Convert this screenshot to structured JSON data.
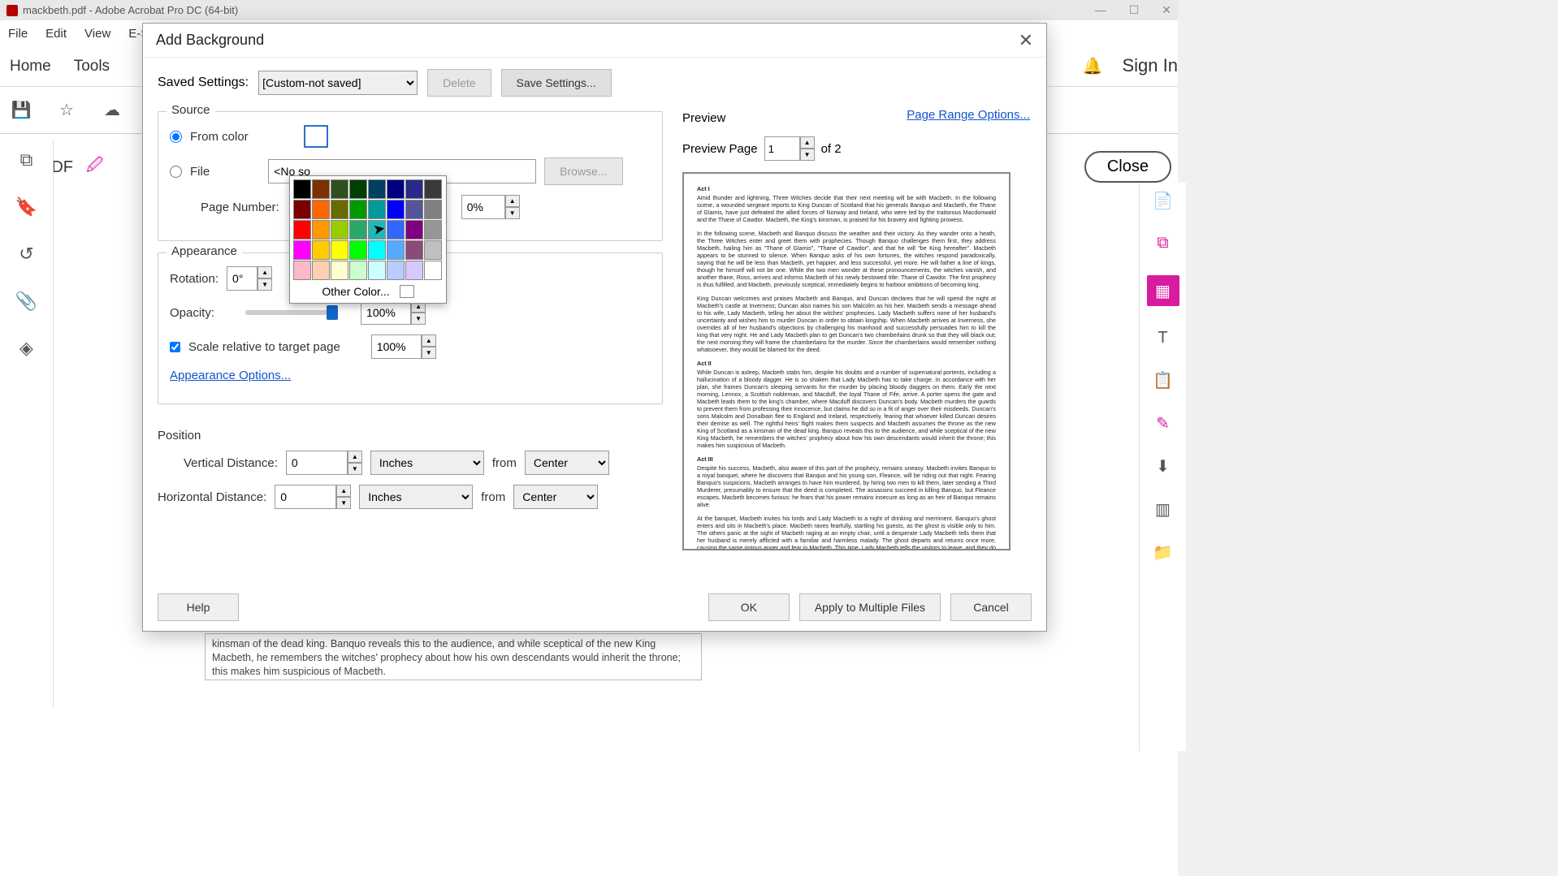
{
  "app": {
    "title": "mackbeth.pdf - Adobe Acrobat Pro DC (64-bit)"
  },
  "menu": {
    "file": "File",
    "edit": "Edit",
    "view": "View",
    "esign": "E-Si"
  },
  "topTabs": {
    "home": "Home",
    "tools": "Tools"
  },
  "signIn": "Sign In",
  "editPdf": "Edit PDF",
  "closeBtn": "Close",
  "dialog": {
    "title": "Add Background",
    "savedSettingsLabel": "Saved Settings:",
    "savedSettingsValue": "[Custom-not saved]",
    "delete": "Delete",
    "saveSettings": "Save Settings...",
    "pageRange": "Page Range Options...",
    "sourceLabel": "Source",
    "fromColor": "From color",
    "file": "File",
    "fileValue": "<No so",
    "browse": "Browse...",
    "pageNumberLabel": "Page Number:",
    "pageNumberValue": "0%",
    "appearanceLabel": "Appearance",
    "rotationLabel": "Rotation:",
    "rotationValue": "0°",
    "opacityLabel": "Opacity:",
    "opacityValue": "100%",
    "scaleLabel": "Scale relative to target page",
    "scaleValue": "100%",
    "appearanceOptions": "Appearance Options...",
    "positionLabel": "Position",
    "vDistLabel": "Vertical Distance:",
    "hDistLabel": "Horizontal Distance:",
    "distValue": "0",
    "unit": "Inches",
    "from": "from",
    "anchor": "Center",
    "help": "Help",
    "ok": "OK",
    "apply": "Apply to Multiple Files",
    "cancel": "Cancel",
    "previewLabel": "Preview",
    "previewPageLabel": "Preview Page",
    "previewPageValue": "1",
    "previewPageTotal": "of 2",
    "otherColor": "Other Color..."
  },
  "colorGrid": [
    "#000000",
    "#7b3100",
    "#2f4f1f",
    "#004000",
    "#003f5f",
    "#000080",
    "#2a2a8a",
    "#3a3a3a",
    "#7a0000",
    "#ff6600",
    "#6a6a00",
    "#009900",
    "#009a9a",
    "#0000ff",
    "#555599",
    "#808080",
    "#ff0000",
    "#ff9900",
    "#99cc00",
    "#2aa86a",
    "#1fb8b8",
    "#3366ff",
    "#800080",
    "#969696",
    "#ff00ff",
    "#ffcc00",
    "#ffff00",
    "#00ff00",
    "#00ffff",
    "#55aaff",
    "#8a4a7a",
    "#c0c0c0",
    "#ffb8c8",
    "#ffd0b0",
    "#ffffcc",
    "#ccffcc",
    "#ccffff",
    "#b8ccff",
    "#d8c8ff",
    "#ffffff"
  ],
  "bottomDoc": "kinsman of the dead king. Banquo reveals this to the audience, and while sceptical of the new King Macbeth, he remembers the witches' prophecy about how his own descendants would inherit the throne; this makes him suspicious of Macbeth.",
  "previewText": {
    "act1": "Act I",
    "p1": "Amid thunder and lightning, Three Witches decide that their next meeting will be with Macbeth. In the following scene, a wounded sergeant reports to King Duncan of Scotland that his generals Banquo and Macbeth, the Thane of Glamis, have just defeated the allied forces of Norway and Ireland, who were led by the traitorous Macdonwald and the Thane of Cawdor. Macbeth, the King's kinsman, is praised for his bravery and fighting prowess.",
    "p2": "In the following scene, Macbeth and Banquo discuss the weather and their victory. As they wander onto a heath, the Three Witches enter and greet them with prophecies. Though Banquo challenges them first, they address Macbeth, hailing him as \"Thane of Glamis\", \"Thane of Cawdor\", and that he will \"be King hereafter\". Macbeth appears to be stunned to silence. When Banquo asks of his own fortunes, the witches respond paradoxically, saying that he will be less than Macbeth, yet happier, and less successful, yet more. He will father a line of kings, though he himself will not be one. While the two men wonder at these pronouncements, the witches vanish, and another thane, Ross, arrives and informs Macbeth of his newly bestowed title: Thane of Cawdor. The first prophecy is thus fulfilled, and Macbeth, previously sceptical, immediately begins to harbour ambitions of becoming king.",
    "p3": "King Duncan welcomes and praises Macbeth and Banquo, and Duncan declares that he will spend the night at Macbeth's castle at Inverness; Duncan also names his son Malcolm as his heir. Macbeth sends a message ahead to his wife, Lady Macbeth, telling her about the witches' prophecies. Lady Macbeth suffers none of her husband's uncertainty and wishes him to murder Duncan in order to obtain kingship. When Macbeth arrives at Inverness, she overrides all of her husband's objections by challenging his manhood and successfully persuades him to kill the king that very night. He and Lady Macbeth plan to get Duncan's two chamberlains drunk so that they will black out; the next morning they will frame the chamberlains for the murder. Since the chamberlains would remember nothing whatsoever, they would be blamed for the deed.",
    "act2": "Act II",
    "p4": "While Duncan is asleep, Macbeth stabs him, despite his doubts and a number of supernatural portents, including a hallucination of a bloody dagger. He is so shaken that Lady Macbeth has to take charge. In accordance with her plan, she frames Duncan's sleeping servants for the murder by placing bloody daggers on them. Early the next morning, Lennox, a Scottish nobleman, and Macduff, the loyal Thane of Fife, arrive. A porter opens the gate and Macbeth leads them to the king's chamber, where Macduff discovers Duncan's body. Macbeth murders the guards to prevent them from professing their innocence, but claims he did so in a fit of anger over their misdeeds. Duncan's sons Malcolm and Donalbain flee to England and Ireland, respectively, fearing that whoever killed Duncan desires their demise as well. The rightful heirs' flight makes them suspects and Macbeth assumes the throne as the new King of Scotland as a kinsman of the dead king. Banquo reveals this to the audience, and while sceptical of the new King Macbeth, he remembers the witches' prophecy about how his own descendants would inherit the throne; this makes him suspicious of Macbeth.",
    "act3": "Act III",
    "p5": "Despite his success, Macbeth, also aware of this part of the prophecy, remains uneasy. Macbeth invites Banquo to a royal banquet, where he discovers that Banquo and his young son, Fleance, will be riding out that night. Fearing Banquo's suspicions, Macbeth arranges to have him murdered, by hiring two men to kill them, later sending a Third Murderer, presumably to ensure that the deed is completed. The assassins succeed in killing Banquo, but Fleance escapes. Macbeth becomes furious: he fears that his power remains insecure as long as an heir of Banquo remains alive.",
    "p6": "At the banquet, Macbeth invites his lords and Lady Macbeth to a night of drinking and merriment. Banquo's ghost enters and sits in Macbeth's place. Macbeth raves fearfully, startling his guests, as the ghost is visible only to him. The others panic at the sight of Macbeth raging at an empty chair, until a desperate Lady Macbeth tells them that her husband is merely afflicted with a familiar and harmless malady. The ghost departs and returns once more, causing the same riotous anger and fear in Macbeth. This time, Lady Macbeth tells the visitors to leave, and they do so. At the end Hecate scolds the three weird sisters for helping Macbeth, especially without consulting her. Hecate instructs the Witches to give Macbeth false security. Note that some scholars believe the Hecate scene was added in later."
  }
}
